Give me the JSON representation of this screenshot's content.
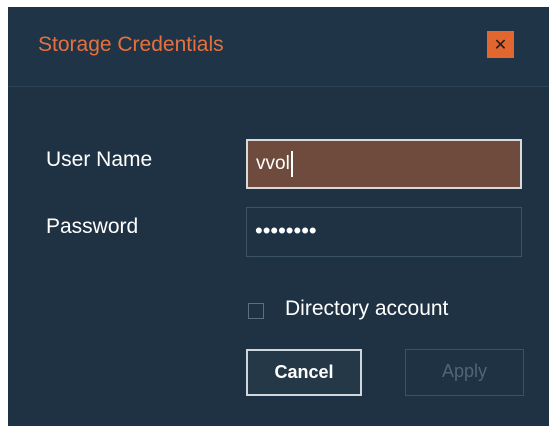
{
  "dialog": {
    "title": "Storage Credentials",
    "close_icon": "close-x-icon",
    "close_glyph": "✕"
  },
  "form": {
    "username_label": "User Name",
    "username_value": "vvol",
    "password_label": "Password",
    "password_value": "••••••••",
    "directory_account_label": "Directory account",
    "directory_account_checked": false
  },
  "buttons": {
    "cancel_label": "Cancel",
    "apply_label": "Apply",
    "apply_enabled": false
  },
  "colors": {
    "dialog_bg": "#1e3244",
    "title_accent": "#e7713e",
    "close_bg": "#e2662f",
    "active_field_bg": "#6e4b3c"
  }
}
